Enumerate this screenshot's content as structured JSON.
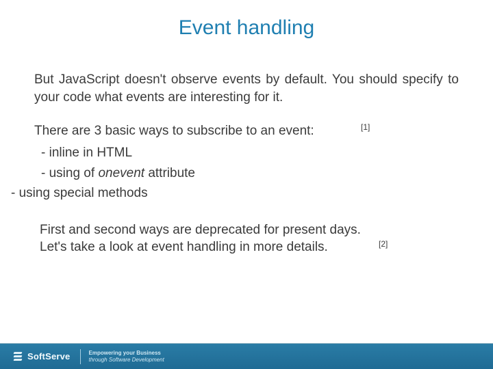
{
  "title": "Event handling",
  "para1": "But JavaScript doesn't observe events by default. You should specify to your code what events are interesting for it.",
  "list_lead": "There are 3 basic ways to subscribe to an event:",
  "artifact1": "[1]",
  "bullets": [
    "- inline in HTML",
    "- using of ",
    "- using special methods"
  ],
  "onevent_word": "onevent",
  "onevent_suffix": " attribute",
  "para2_line1": "First and second ways are deprecated for present days.",
  "para2_line2": "Let's take a look at event handling in more details.",
  "artifact2": "[2]",
  "footer": {
    "brand": "SoftServe",
    "tagline1": "Empowering your Business",
    "tagline2": "through Software Development"
  }
}
